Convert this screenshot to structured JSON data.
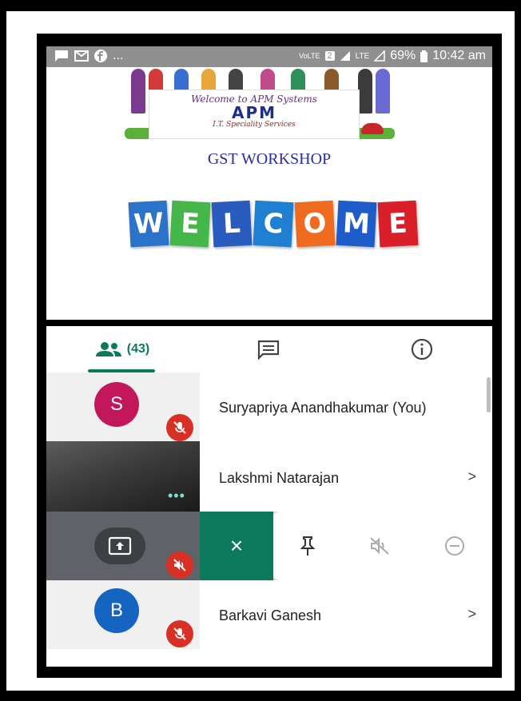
{
  "statusbar": {
    "left_icons": [
      "message-icon",
      "gmail-icon",
      "facebook-icon",
      "more-dots"
    ],
    "more_dots": "...",
    "volte": "VoLTE",
    "sim": "2",
    "lte": "LTE",
    "battery": "69%",
    "time": "10:42 am"
  },
  "slide": {
    "banner_welcome": "Welcome to APM Systems",
    "banner_logo": "APM",
    "banner_sub": "I.T. Speciality Services",
    "title": "GST WORKSHOP",
    "welcome_letters": [
      "W",
      "E",
      "L",
      "C",
      "O",
      "M",
      "E"
    ],
    "welcome_colors": [
      "#2a73c9",
      "#45b649",
      "#2a5bbf",
      "#1f7fd1",
      "#ef6b1f",
      "#1f5cc9",
      "#d81f2a"
    ]
  },
  "tabs": {
    "people_count": "(43)",
    "chat_icon": "chat-icon",
    "info_icon": "info-icon",
    "accent": "#0b7a5c"
  },
  "participants": [
    {
      "initial": "S",
      "name": "Suryapriya Anandhakumar (You)",
      "avatar_color": "#c2185b",
      "muted": true
    },
    {
      "initial": "",
      "name": "Lakshmi Natarajan",
      "video": true,
      "chevron": ">"
    },
    {
      "initial": "B",
      "name": "Barkavi Ganesh",
      "avatar_color": "#1565c0",
      "muted": true,
      "chevron": ">"
    }
  ],
  "actions": {
    "close": "×",
    "pin_icon": "pin-icon",
    "mute_icon": "mute-icon",
    "remove_icon": "remove-icon",
    "present_icon": "present-screen-icon",
    "more_options": "•••"
  }
}
